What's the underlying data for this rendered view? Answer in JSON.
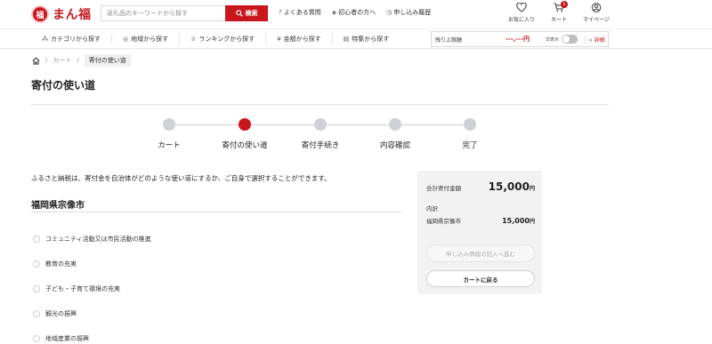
{
  "header": {
    "logo_mark": "福",
    "logo_text": "まん福",
    "search_placeholder": "返礼品のキーワードから探す",
    "search_button": "検索",
    "links": [
      {
        "icon": "question-circle-icon",
        "glyph": "?",
        "label": "よくある質問"
      },
      {
        "icon": "beginner-icon",
        "glyph": "◈",
        "label": "初心者の方へ"
      },
      {
        "icon": "history-icon",
        "glyph": "◷",
        "label": "申し込み履歴"
      }
    ],
    "icons": [
      {
        "icon": "heart-icon",
        "label": "お気に入り"
      },
      {
        "icon": "cart-icon",
        "label": "カート",
        "badge": "1"
      },
      {
        "icon": "user-icon",
        "label": "マイページ"
      }
    ]
  },
  "nav": {
    "items": [
      {
        "icon": "category-icon",
        "glyph": "⁂",
        "label": "カテゴリから探す"
      },
      {
        "icon": "map-icon",
        "glyph": "◎",
        "label": "地域から探す"
      },
      {
        "icon": "ranking-icon",
        "glyph": "♕",
        "label": "ランキングから探す"
      },
      {
        "icon": "yen-icon",
        "glyph": "¥",
        "label": "金額から探す"
      },
      {
        "icon": "feature-icon",
        "glyph": "▤",
        "label": "特集から探す"
      }
    ],
    "limit": {
      "label": "残り上限額",
      "value": "---,---円",
      "toggle_label": "非表示",
      "detail": "» 詳細"
    }
  },
  "breadcrumb": {
    "items": [
      "カート"
    ],
    "current": "寄付の使い道",
    "sep": "/"
  },
  "page_title": "寄付の使い道",
  "steps": [
    {
      "label": "カート",
      "active": false
    },
    {
      "label": "寄付の使い道",
      "active": true
    },
    {
      "label": "寄付手続き",
      "active": false
    },
    {
      "label": "内容確認",
      "active": false
    },
    {
      "label": "完了",
      "active": false
    }
  ],
  "intro": "ふるさと納税は、寄付金を自治体がどのような使い道にするか、ご自身で選択することができます。",
  "prefecture": "福岡県宗像市",
  "uses": [
    "コミュニティ活動又は市民活動の推進",
    "教育の充実",
    "子ども・子育て環境の充実",
    "観光の振興",
    "地域産業の振興"
  ],
  "summary": {
    "total_label": "合計寄付金額",
    "total_value": "15,000",
    "yen": "円",
    "breakdown_label": "内訳",
    "item_label": "福岡県宗像市",
    "item_value": "15,000",
    "next_button": "申し込み情報の記入へ進む",
    "back_button": "カートに戻る"
  }
}
